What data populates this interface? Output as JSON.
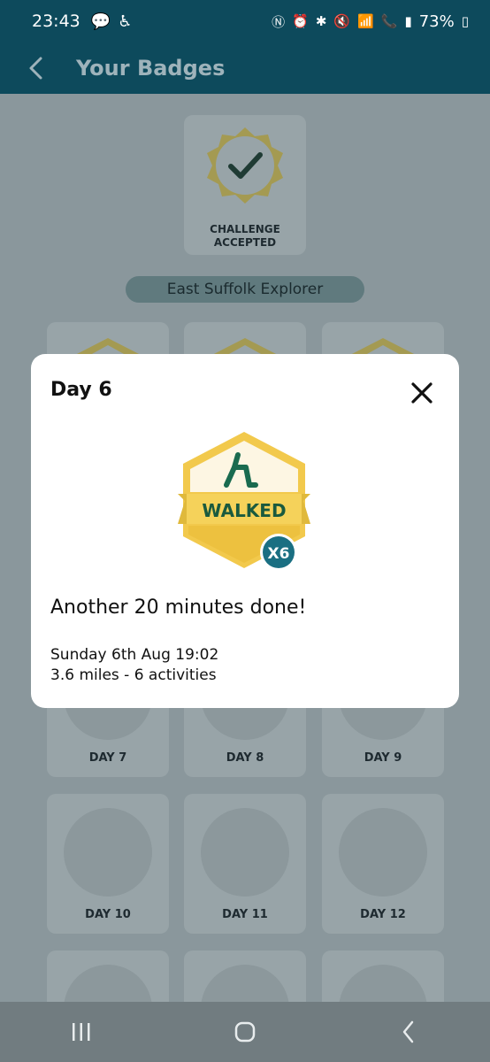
{
  "status_bar": {
    "time": "23:43",
    "battery": "73%",
    "icons": [
      "chat-icon",
      "accessibility-icon",
      "nfc-icon",
      "alarm-icon",
      "bluetooth-icon",
      "mute-icon",
      "wifi-icon",
      "wifi-call-icon",
      "signal-icon",
      "battery-icon"
    ]
  },
  "header": {
    "title": "Your Badges"
  },
  "page": {
    "challenge_badge": {
      "line1": "CHALLENGE",
      "line2": "ACCEPTED"
    },
    "challenge_name": "East Suffolk Explorer",
    "day_tiles": [
      "DAY 7",
      "DAY 8",
      "DAY 9",
      "DAY 10",
      "DAY 11",
      "DAY 12"
    ]
  },
  "modal": {
    "title": "Day 6",
    "badge_text": "WALKED",
    "badge_count": "X6",
    "message": "Another 20 minutes done!",
    "date": "Sunday 6th Aug 19:02",
    "stats": "3.6 miles - 6 activities"
  },
  "colors": {
    "header_bg": "#0d4a5c",
    "badge_yellow": "#f2c94c",
    "badge_green": "#1a6b4f",
    "count_bubble": "#1a6f82"
  }
}
